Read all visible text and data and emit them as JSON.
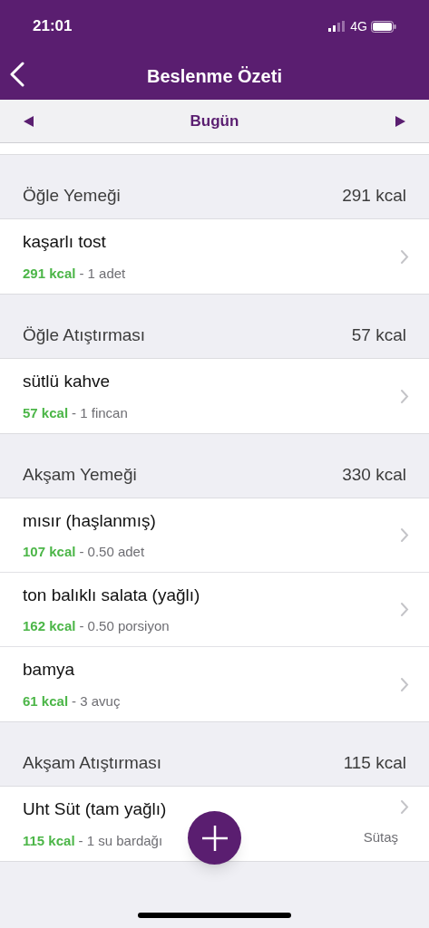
{
  "status_bar": {
    "time": "21:01",
    "network": "4G"
  },
  "nav": {
    "title": "Beslenme Özeti"
  },
  "date_bar": {
    "label": "Bugün"
  },
  "meals": [
    {
      "name": "Öğle Yemeği",
      "total": "291 kcal",
      "items": [
        {
          "name": "kaşarlı tost",
          "kcal": "291 kcal",
          "amount": "- 1 adet"
        }
      ]
    },
    {
      "name": "Öğle Atıştırması",
      "total": "57 kcal",
      "items": [
        {
          "name": "sütlü kahve",
          "kcal": "57 kcal",
          "amount": "- 1 fincan"
        }
      ]
    },
    {
      "name": "Akşam Yemeği",
      "total": "330 kcal",
      "items": [
        {
          "name": "mısır (haşlanmış)",
          "kcal": "107 kcal",
          "amount": "- 0.50 adet"
        },
        {
          "name": "ton balıklı salata (yağlı)",
          "kcal": "162 kcal",
          "amount": "- 0.50 porsiyon"
        },
        {
          "name": "bamya",
          "kcal": "61 kcal",
          "amount": "- 3 avuç"
        }
      ]
    },
    {
      "name": "Akşam Atıştırması",
      "total": "115 kcal",
      "items": [
        {
          "name": "Uht Süt (tam yağlı)",
          "kcal": "115 kcal",
          "amount": "- 1 su bardağı",
          "brand": "Sütaş"
        }
      ]
    }
  ]
}
